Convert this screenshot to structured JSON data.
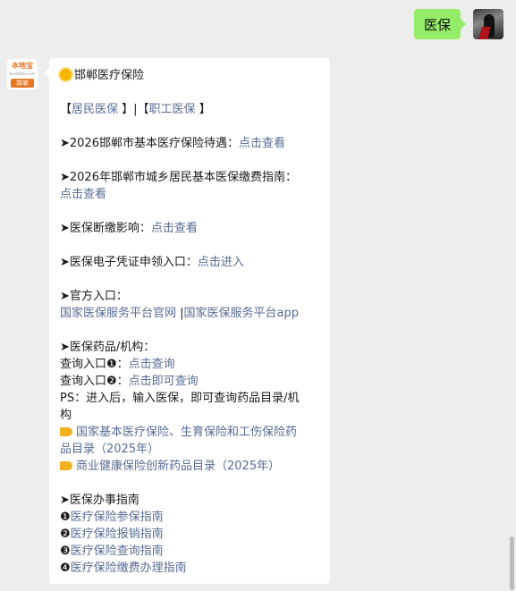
{
  "outgoing": {
    "text": "医保"
  },
  "bot": {
    "logo_top": "本地宝",
    "logo_mid": "BenDiBao.com",
    "logo_city": "邯郸"
  },
  "message": {
    "title": "邯郸医疗保险",
    "tab_open1": "【",
    "tab_link1": "居民医保",
    "tab_close1": " 】|【",
    "tab_link2": "职工医保",
    "tab_close2": " 】",
    "s1_label": "➤2026邯郸市基本医疗保险待遇：",
    "s1_link": "点击查看",
    "s2_label": "➤2026年邯郸市城乡居民基本医保缴费指南：",
    "s2_link": "点击查看",
    "s3_label": "➤医保断缴影响：",
    "s3_link": "点击查看",
    "s4_label": "➤医保电子凭证申领入口：",
    "s4_link": "点击进入",
    "s5_label": "➤官方入口：",
    "s5_link1": "国家医保服务平台官网",
    "s5_sep": " |",
    "s5_link2": "国家医保服务平台app",
    "s6_label": "➤医保药品/机构：",
    "q1_label": "查询入口❶：",
    "q1_link": "点击查询",
    "q2_label": "查询入口❷：",
    "q2_link": "点击即可查询",
    "ps_line1": "PS：进入后，输入医保，即可查询药品目录/机",
    "ps_line2": "构",
    "drug1_line1": "国家基本医疗保险、生育保险和工伤保险药",
    "drug1_line2": "品目录（2025年）",
    "drug2": "商业健康保险创新药品目录（2025年）",
    "s7_label": "➤医保办事指南",
    "g1_num": "❶",
    "g1_link": "医疗保险参保指南",
    "g2_num": "❷",
    "g2_link": "医疗保险报销指南",
    "g3_num": "❸",
    "g3_link": "医疗保险查询指南",
    "g4_num": "❹",
    "g4_link": "医疗保险缴费办理指南"
  }
}
